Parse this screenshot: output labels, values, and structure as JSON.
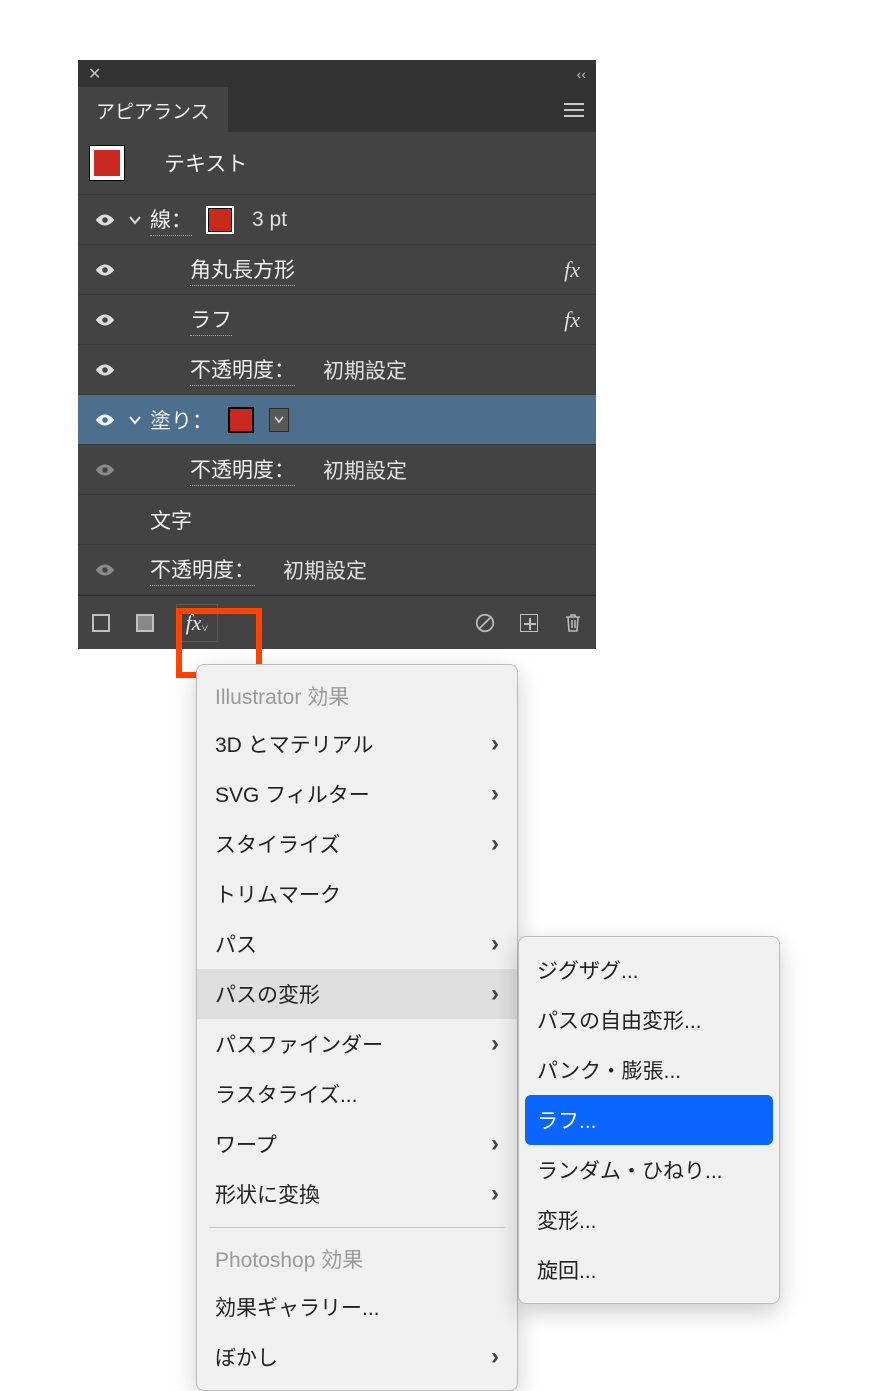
{
  "panel": {
    "tab_title": "アピアランス",
    "target_label": "テキスト",
    "rows": {
      "stroke_label": "線：",
      "stroke_weight": "3 pt",
      "effect_round": "角丸長方形",
      "effect_rough": "ラフ",
      "opacity_label": "不透明度：",
      "opacity_value": "初期設定",
      "fill_label": "塗り：",
      "characters_label": "文字"
    },
    "colors": {
      "stroke": "#c9291f",
      "fill": "#c9291f"
    }
  },
  "menu1": {
    "header1": "Illustrator 効果",
    "items1": [
      {
        "label": "3D とマテリアル",
        "submenu": true
      },
      {
        "label": "SVG フィルター",
        "submenu": true
      },
      {
        "label": "スタイライズ",
        "submenu": true
      },
      {
        "label": "トリムマーク",
        "submenu": false
      },
      {
        "label": "パス",
        "submenu": true
      },
      {
        "label": "パスの変形",
        "submenu": true,
        "hover": true
      },
      {
        "label": "パスファインダー",
        "submenu": true
      },
      {
        "label": "ラスタライズ...",
        "submenu": false
      },
      {
        "label": "ワープ",
        "submenu": true
      },
      {
        "label": "形状に変換",
        "submenu": true
      }
    ],
    "header2": "Photoshop 効果",
    "items2": [
      {
        "label": "効果ギャラリー...",
        "submenu": false
      },
      {
        "label": "ぼかし",
        "submenu": true
      }
    ]
  },
  "menu2": {
    "items": [
      {
        "label": "ジグザグ..."
      },
      {
        "label": "パスの自由変形..."
      },
      {
        "label": "パンク・膨張..."
      },
      {
        "label": "ラフ...",
        "selected": true
      },
      {
        "label": "ランダム・ひねり..."
      },
      {
        "label": "変形..."
      },
      {
        "label": "旋回..."
      }
    ]
  }
}
